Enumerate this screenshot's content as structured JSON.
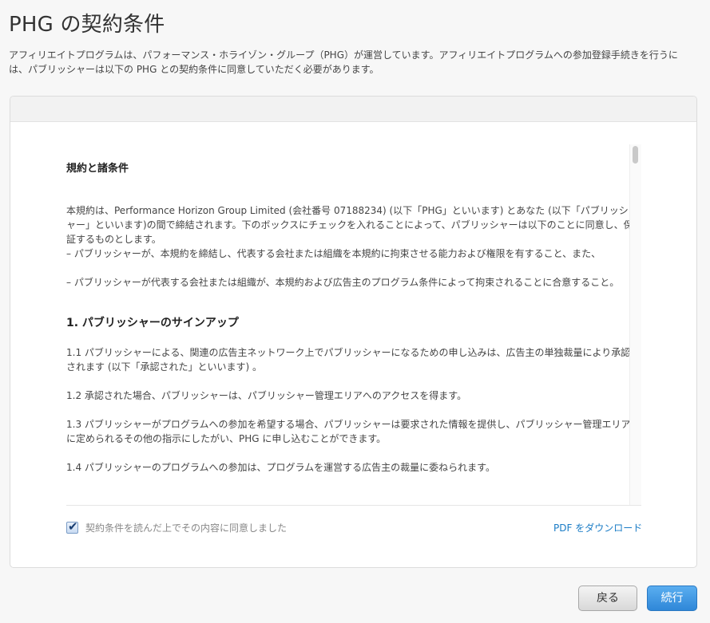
{
  "page": {
    "title": "PHG の契約条件",
    "intro": "アフィリエイトプログラムは、パフォーマンス・ホライゾン・グループ（PHG）が運営しています。アフィリエイトプログラムへの参加登録手続きを行うには、パブリッシャーは以下の PHG との契約条件に同意していただく必要があります。"
  },
  "terms": {
    "heading": "規約と諸条件",
    "preamble": "本規約は、Performance Horizon Group Limited (会社番号 07188234) (以下「PHG」といいます) とあなた (以下「パブリッシャー」といいます)の間で締結されます。下のボックスにチェックを入れることによって、パブリッシャーは以下のことに同意し、保証するものとします。",
    "bullet_1": "– パブリッシャーが、本規約を締結し、代表する会社または組織を本規約に拘束させる能力および権限を有すること、また、",
    "bullet_2": "– パブリッシャーが代表する会社または組織が、本規約および広告主のプログラム条件によって拘束されることに合意すること。",
    "section_1_title": "1. パブリッシャーのサインアップ",
    "clause_1_1": "1.1 パブリッシャーによる、関連の広告主ネットワーク上でパブリッシャーになるための申し込みは、広告主の単独裁量により承認されます (以下「承認された」といいます) 。",
    "clause_1_2": "1.2 承認された場合、パブリッシャーは、パブリッシャー管理エリアへのアクセスを得ます。",
    "clause_1_3": "1.3 パブリッシャーがプログラムへの参加を希望する場合、パブリッシャーは要求された情報を提供し、パブリッシャー管理エリアに定められるその他の指示にしたがい、PHG に申し込むことができます。",
    "clause_1_4": "1.4 パブリッシャーのプログラムへの参加は、プログラムを運営する広告主の裁量に委ねられます。"
  },
  "agreement": {
    "checkbox_checked": true,
    "checkbox_label": "契約条件を読んだ上でその内容に同意しました",
    "pdf_link": "PDF をダウンロード"
  },
  "buttons": {
    "back": "戻る",
    "continue": "続行"
  },
  "colors": {
    "link": "#1a7cc6",
    "primary_button": "#2f87d8"
  }
}
